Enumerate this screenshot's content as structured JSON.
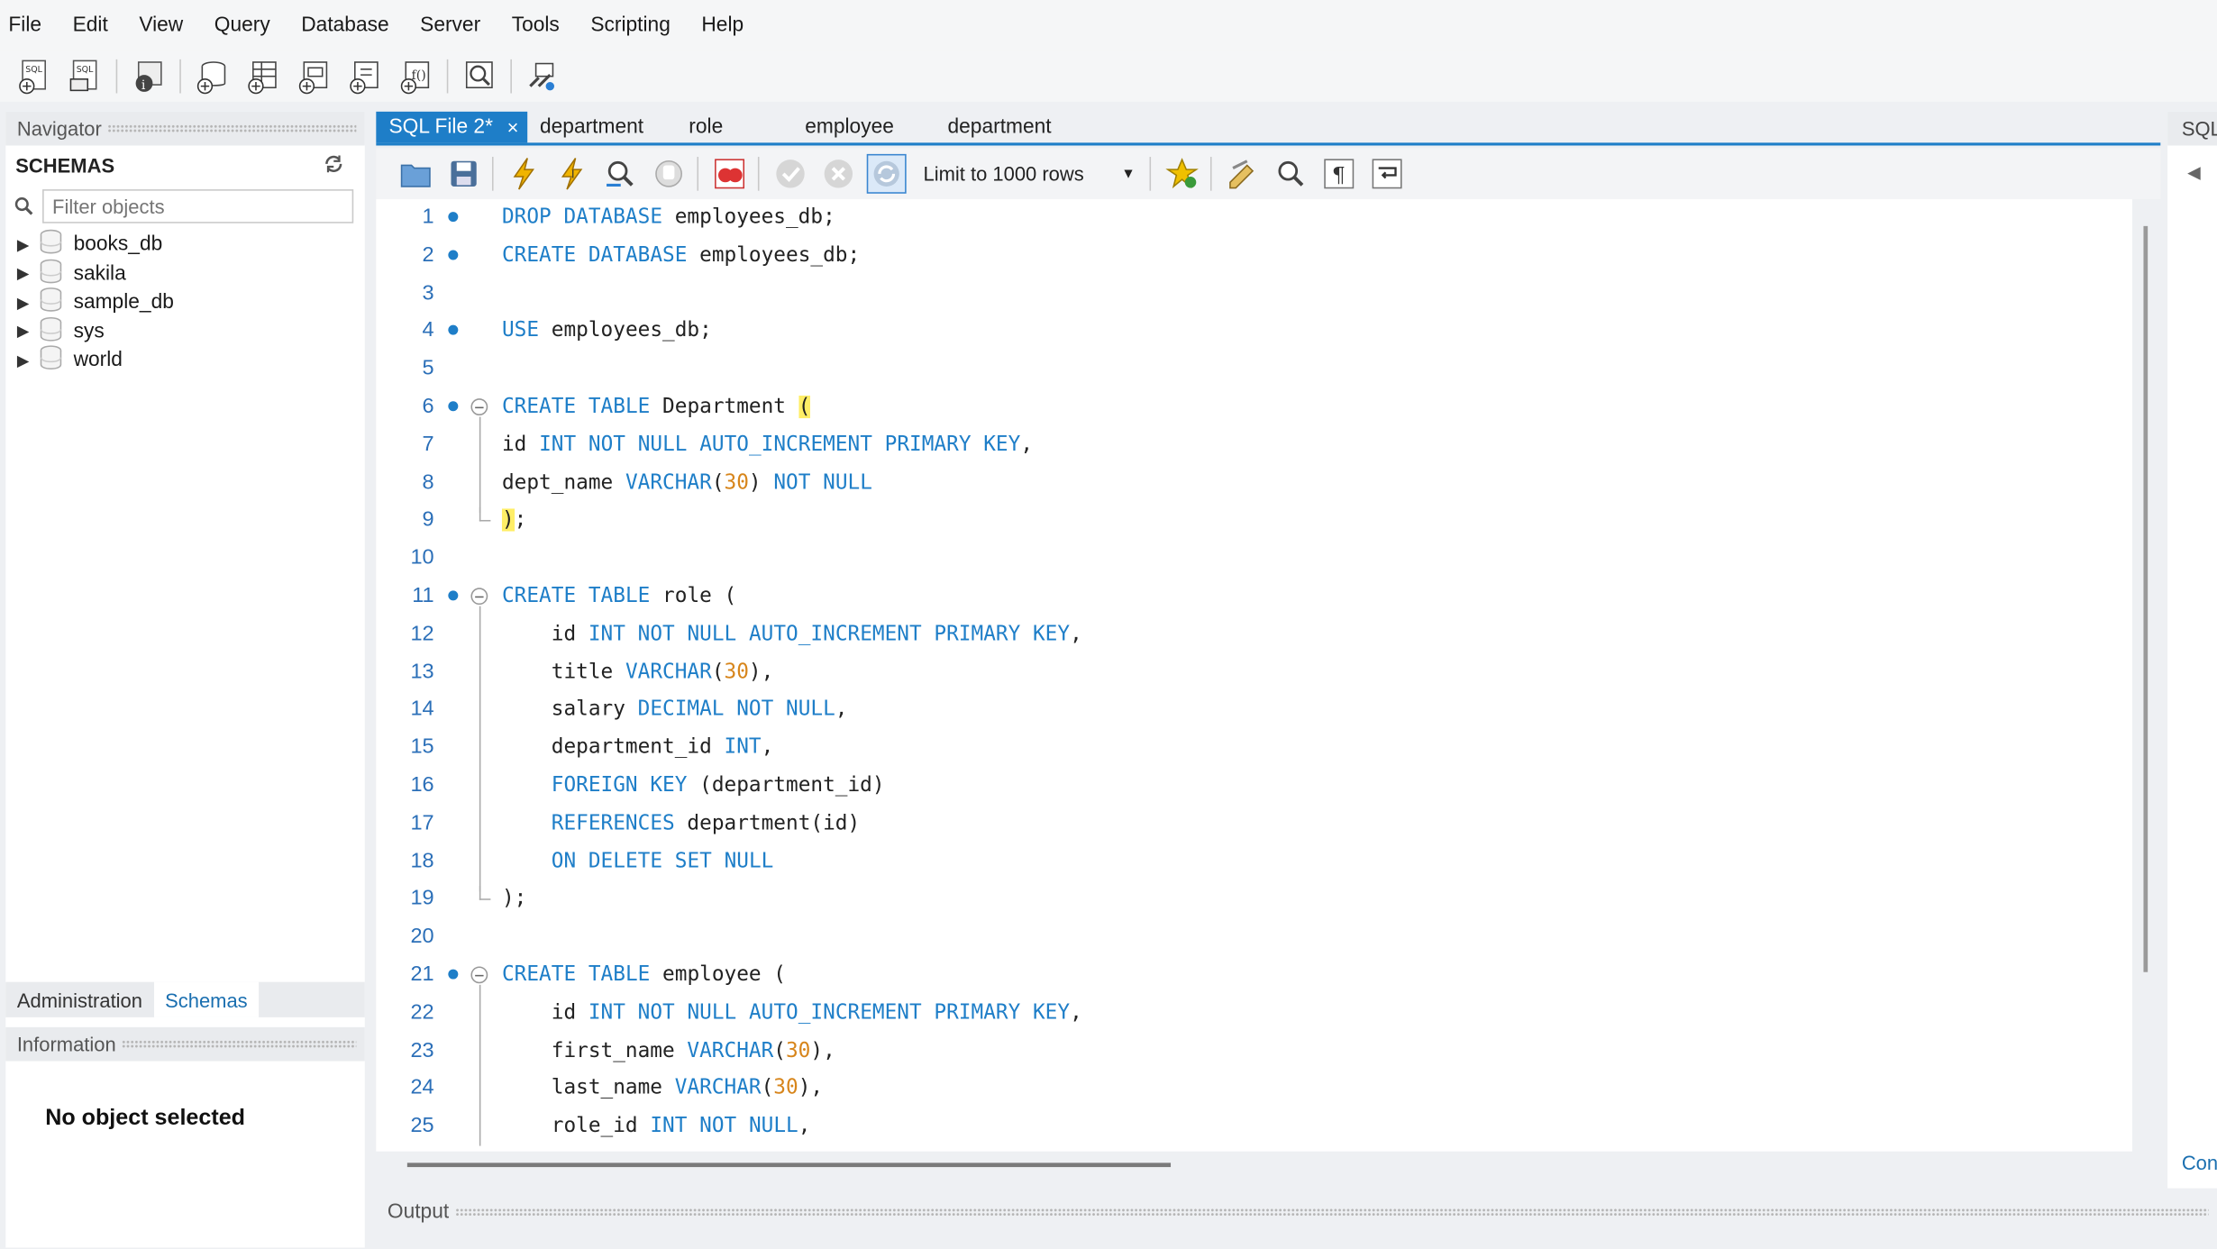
{
  "menu": [
    "File",
    "Edit",
    "View",
    "Query",
    "Database",
    "Server",
    "Tools",
    "Scripting",
    "Help"
  ],
  "navigator": {
    "title": "Navigator",
    "schemas_label": "SCHEMAS",
    "filter_placeholder": "Filter objects",
    "schemas": [
      "books_db",
      "sakila",
      "sample_db",
      "sys",
      "world"
    ],
    "tabs": [
      "Administration",
      "Schemas"
    ],
    "info_title": "Information",
    "no_object": "No object selected"
  },
  "tabs": [
    "SQL File 2*",
    "department",
    "role",
    "employee",
    "department"
  ],
  "limit_label": "Limit to 1000 rows",
  "right_panel_title": "SQL",
  "right_panel_bottom": "Con",
  "output_title": "Output",
  "code_lines": [
    "DROP DATABASE employees_db;",
    "CREATE DATABASE employees_db;",
    "",
    "USE employees_db;",
    "",
    "CREATE TABLE Department (",
    "id INT NOT NULL AUTO_INCREMENT PRIMARY KEY,",
    "dept_name VARCHAR(30) NOT NULL",
    ");",
    "",
    "CREATE TABLE role (",
    "    id INT NOT NULL AUTO_INCREMENT PRIMARY KEY,",
    "    title VARCHAR(30),",
    "    salary DECIMAL NOT NULL,",
    "    department_id INT,",
    "    FOREIGN KEY (department_id)",
    "    REFERENCES department(id)",
    "    ON DELETE SET NULL",
    ");",
    "",
    "CREATE TABLE employee (",
    "    id INT NOT NULL AUTO_INCREMENT PRIMARY KEY,",
    "    first_name VARCHAR(30),",
    "    last_name VARCHAR(30),",
    "    role_id INT NOT NULL,"
  ],
  "statement_lines": [
    1,
    2,
    4,
    6,
    11,
    21
  ],
  "fold_lines": [
    6,
    11,
    21
  ],
  "colors": {
    "keyword": "#1e7ec8",
    "number": "#d7851b",
    "accent": "#1e7ec8",
    "bracket_highlight": "#ffee66"
  }
}
